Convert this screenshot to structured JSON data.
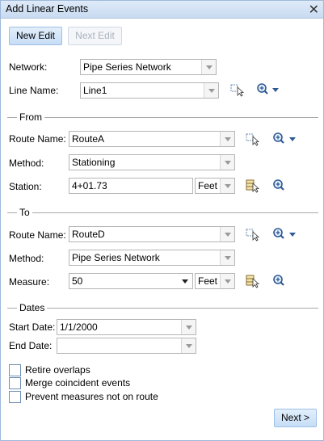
{
  "window": {
    "title": "Add Linear Events"
  },
  "toolbar": {
    "new_edit": "New Edit",
    "next_edit": "Next Edit"
  },
  "network": {
    "label": "Network:",
    "value": "Pipe Series Network"
  },
  "line_name": {
    "label": "Line Name:",
    "value": "Line1"
  },
  "from": {
    "section": "From",
    "route_label": "Route Name:",
    "route_value": "RouteA",
    "method_label": "Method:",
    "method_value": "Stationing",
    "station_label": "Station:",
    "station_value": "4+01.73",
    "unit": "Feet"
  },
  "to": {
    "section": "To",
    "route_label": "Route Name:",
    "route_value": "RouteD",
    "method_label": "Method:",
    "method_value": "Pipe Series Network",
    "measure_label": "Measure:",
    "measure_value": "50",
    "unit": "Feet"
  },
  "dates": {
    "section": "Dates",
    "start_label": "Start Date:",
    "start_value": "1/1/2000",
    "end_label": "End Date:",
    "end_value": ""
  },
  "options": {
    "retire": "Retire overlaps",
    "merge": "Merge coincident events",
    "prevent": "Prevent measures not on route"
  },
  "footer": {
    "next": "Next >"
  }
}
